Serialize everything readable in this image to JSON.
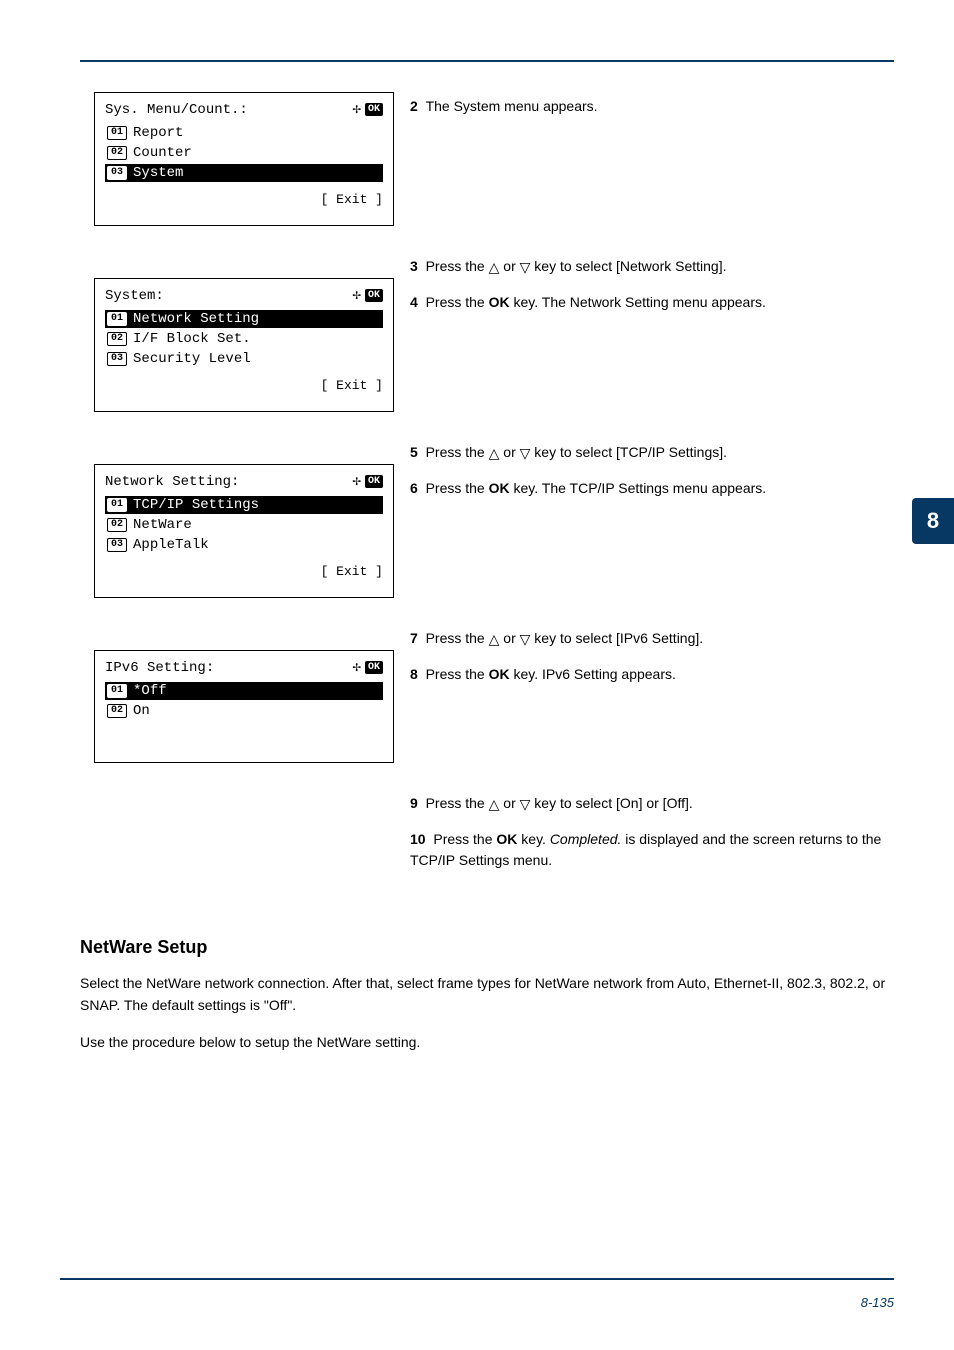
{
  "sideTab": "8",
  "pageNumber": "8-135",
  "screens": [
    {
      "title": "Sys. Menu/Count.:",
      "items": [
        "Report",
        "Counter",
        "System"
      ],
      "highlightIndex": 2,
      "footer": "[ Exit ]"
    },
    {
      "title": "System:",
      "items": [
        "Network Setting",
        "I/F Block Set.",
        "Security Level"
      ],
      "highlightIndex": 0,
      "footer": "[ Exit ]"
    },
    {
      "title": "Network Setting:",
      "items": [
        "TCP/IP Settings",
        "NetWare",
        "AppleTalk"
      ],
      "highlightIndex": 0,
      "footer": "[ Exit ]"
    },
    {
      "title": "IPv6 Setting:",
      "items": [
        "Off",
        "On"
      ],
      "highlightIndex": 0,
      "footer": ""
    }
  ],
  "step2": {
    "text": "The System menu appears."
  },
  "step3": {
    "text1": "Press the ",
    "text2": " or ",
    "text3": " key to select [Network Setting]."
  },
  "step4": {
    "text1": "Press the ",
    "ok": "OK",
    "text2": " key. The Network Setting menu appears."
  },
  "step5": {
    "text1": "Press the ",
    "text2": " or ",
    "text3": " key to select [TCP/IP Settings]."
  },
  "step6": {
    "text1": "Press the ",
    "ok": "OK",
    "text2": " key. The TCP/IP Settings menu appears."
  },
  "step7": {
    "text1": "Press the ",
    "text2": " or ",
    "text3": " key to select [IPv6 Setting]."
  },
  "step8": {
    "text1": "Press the ",
    "ok": "OK",
    "text2": " key. IPv6 Setting appears."
  },
  "step9": {
    "text1": "Press the ",
    "text2": " or ",
    "text3": " key to select [On] or [Off]."
  },
  "step10": {
    "text1": "Press the ",
    "ok": "OK",
    "text2": " key. ",
    "completed": "Completed.",
    "text3": " is displayed and the screen returns to the TCP/IP Settings menu."
  },
  "netware": {
    "heading": "NetWare Setup",
    "para1a": "Select the NetWare network connection. After that, select frame types for NetWare network from Auto, Ethernet-II, 802.3, 802.2, or SNAP. The default settings is \"",
    "para1off": "Off",
    "para1b": "\".",
    "para2": "Use the procedure below to setup the NetWare setting."
  },
  "icons": {
    "arrows": "✢",
    "ok": "OK",
    "triUp": "△",
    "triDn": "▽"
  },
  "stepNums": {
    "s2": "2",
    "s3": "3",
    "s4": "4",
    "s5": "5",
    "s6": "6",
    "s7": "7",
    "s8": "8",
    "s9": "9",
    "s10": "10"
  }
}
